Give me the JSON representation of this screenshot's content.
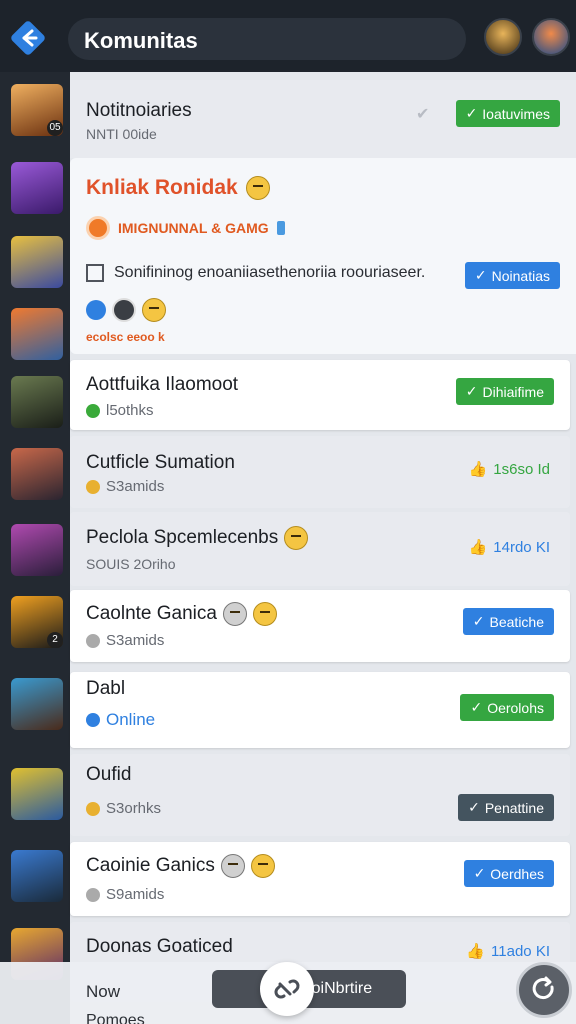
{
  "header": {
    "title": "Komunitas",
    "back_icon": "arrow-left-icon",
    "accent": "#2f80e0"
  },
  "rail": {
    "avatars": [
      {
        "name": "game-avatar-1",
        "badge": "05"
      },
      {
        "name": "game-avatar-2",
        "badge": ""
      },
      {
        "name": "game-avatar-3",
        "badge": ""
      },
      {
        "name": "game-avatar-4",
        "badge": ""
      },
      {
        "name": "game-avatar-5",
        "badge": ""
      },
      {
        "name": "game-avatar-6",
        "badge": ""
      },
      {
        "name": "game-avatar-7",
        "badge": ""
      },
      {
        "name": "game-avatar-8",
        "badge": "2"
      },
      {
        "name": "game-avatar-9",
        "badge": ""
      },
      {
        "name": "game-avatar-10",
        "badge": ""
      },
      {
        "name": "game-avatar-11",
        "badge": ""
      },
      {
        "name": "game-avatar-12",
        "badge": ""
      }
    ]
  },
  "list": {
    "notice": {
      "title": "Notitnoiaries",
      "subtitle": "NNTI 00ide",
      "button": "Ioatuvimes"
    },
    "featured": {
      "title": "Knliak Ronidak",
      "tag": "IMIGNUNNAL & GAMG",
      "description": "Sonifininog enoaniiasethenoriia roouriaseer.",
      "button": "Noinatias",
      "footer": "ecolsc eeoo k"
    },
    "rows": [
      {
        "title": "Aottfuika Ilaomoot",
        "subtitle": "l5othks",
        "action": "Dihiaifime",
        "action_style": "green"
      },
      {
        "title": "Cutficle Sumation",
        "subtitle": "S3amids",
        "action": "1s6so Id",
        "action_style": "stat-green"
      },
      {
        "title": "Peclola Spcemlecenbs",
        "subtitle": "SOUIS 2Oriho",
        "action": "14rdo KI",
        "action_style": "stat-blue"
      },
      {
        "title": "Caolnte Ganica",
        "subtitle": "S3amids",
        "action": "Beatiche",
        "action_style": "blue"
      },
      {
        "title": "Dabl",
        "subtitle": "Online",
        "action": "Oerolohs",
        "action_style": "green"
      },
      {
        "title": "Oufid",
        "subtitle": "S3orhks",
        "action": "Penattine",
        "action_style": "dark"
      },
      {
        "title": "Caoinie Ganics",
        "subtitle": "S9amids",
        "action": "Oerdhes",
        "action_style": "blue"
      },
      {
        "title": "Doonas Goaticed",
        "subtitle": "",
        "action": "11ado KI",
        "action_style": "stat-blue"
      }
    ]
  },
  "bottom": {
    "now_label": "Now",
    "tip": "Pomoes",
    "toast": "Dem CoiNbrtire"
  }
}
